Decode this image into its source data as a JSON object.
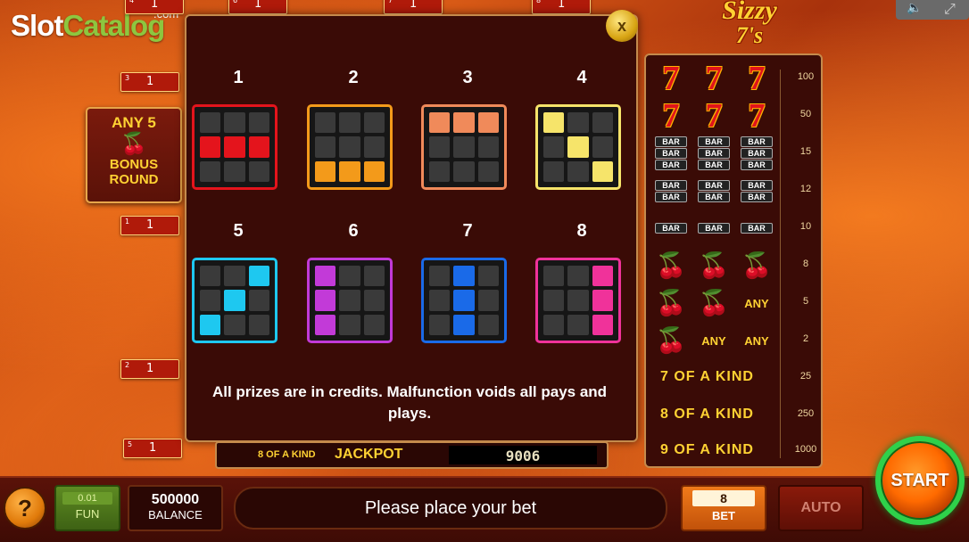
{
  "watermark": {
    "brand_white": "Slot",
    "brand_green": "Catalog",
    "suffix": ".com"
  },
  "game_title": {
    "line1": "Sizzy",
    "line2": "7's"
  },
  "line_markers": [
    {
      "small": "4",
      "big": "1"
    },
    {
      "small": "6",
      "big": "1"
    },
    {
      "small": "7",
      "big": "1"
    },
    {
      "small": "8",
      "big": "1"
    },
    {
      "small": "3",
      "big": "1"
    },
    {
      "small": "1",
      "big": "1"
    },
    {
      "small": "2",
      "big": "1"
    },
    {
      "small": "5",
      "big": "1"
    }
  ],
  "bonus": {
    "line1": "ANY 5",
    "line2": "BONUS",
    "line3": "ROUND",
    "icon": "cherry-icon"
  },
  "paylines": {
    "close_label": "x",
    "lines": [
      {
        "num": "1",
        "color": "#e4141c"
      },
      {
        "num": "2",
        "color": "#f39a1a"
      },
      {
        "num": "3",
        "color": "#f08a5a"
      },
      {
        "num": "4",
        "color": "#f6e46a"
      },
      {
        "num": "5",
        "color": "#1ec8f0"
      },
      {
        "num": "6",
        "color": "#c23ad8"
      },
      {
        "num": "7",
        "color": "#1a6ae8"
      },
      {
        "num": "8",
        "color": "#f0329a"
      }
    ],
    "note": "All prizes are in credits. Malfunction voids all pays and plays."
  },
  "jackpot": {
    "label": "8 OF A KIND",
    "title": "JACKPOT",
    "value": "9006"
  },
  "paytable": [
    {
      "symbols": [
        "seven",
        "seven",
        "seven"
      ],
      "value": "100"
    },
    {
      "symbols": [
        "seven",
        "seven",
        "seven"
      ],
      "value": "50"
    },
    {
      "symbols": [
        "bar3",
        "bar3",
        "bar3"
      ],
      "value": "15"
    },
    {
      "symbols": [
        "bar2",
        "bar2",
        "bar2"
      ],
      "value": "12"
    },
    {
      "symbols": [
        "bar1",
        "bar1",
        "bar1"
      ],
      "value": "10"
    },
    {
      "symbols": [
        "cherry",
        "cherry",
        "cherry"
      ],
      "value": "8"
    },
    {
      "symbols": [
        "cherry",
        "cherry",
        "any"
      ],
      "value": "5"
    },
    {
      "symbols": [
        "cherry",
        "any",
        "any"
      ],
      "value": "2"
    },
    {
      "kind": "7 OF A KIND",
      "value": "25"
    },
    {
      "kind": "8 OF A KIND",
      "value": "250"
    },
    {
      "kind": "9 OF A KIND",
      "value": "1000"
    }
  ],
  "symbol_text": {
    "seven": "7",
    "bar": "BAR",
    "any": "ANY",
    "cherry": "🍒"
  },
  "controls": {
    "help_label": "?",
    "fun_value": "0.01",
    "fun_label": "FUN",
    "balance_value": "500000",
    "balance_label": "BALANCE",
    "message": "Please place your bet",
    "bet_value": "8",
    "bet_label": "BET",
    "auto_label": "AUTO",
    "start_label": "START"
  },
  "top_controls": {
    "sound_icon": "speaker-icon",
    "fullscreen_icon": "fullscreen-icon"
  }
}
